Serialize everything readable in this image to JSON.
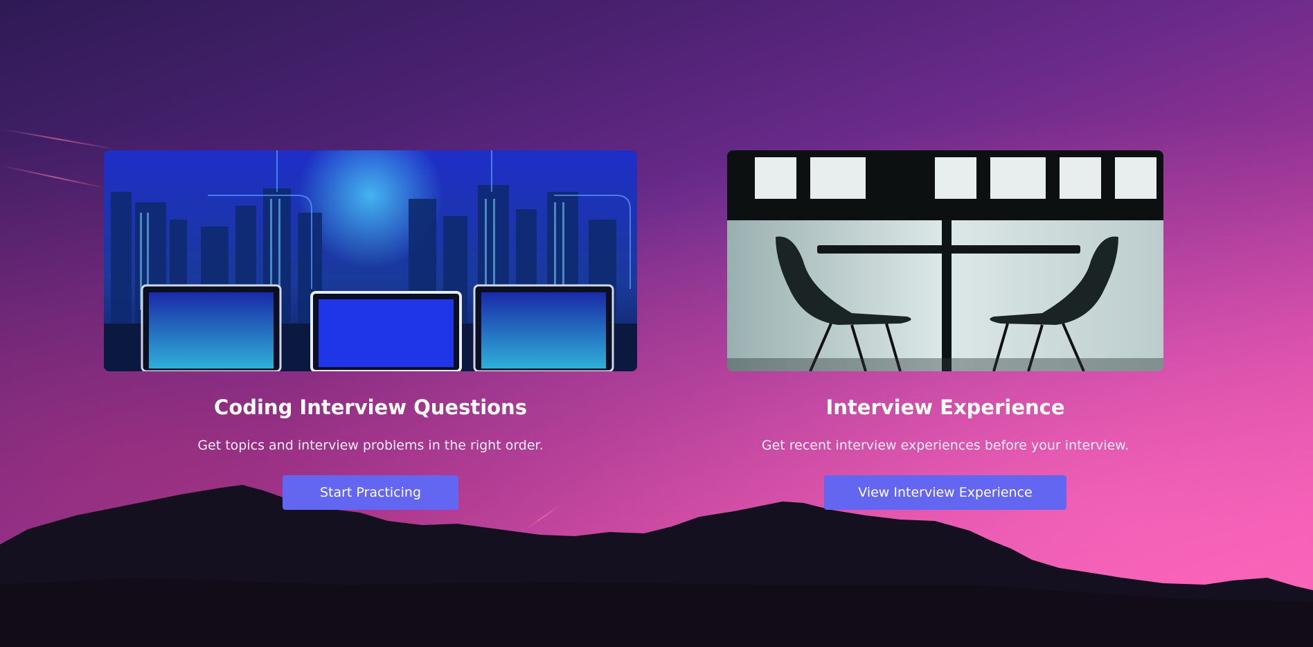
{
  "cards": [
    {
      "title": "Coding Interview Questions",
      "description": "Get topics and interview problems in the right order.",
      "button_label": "Start Practicing",
      "image": "city-binary-laptops-illustration"
    },
    {
      "title": "Interview Experience",
      "description": "Get recent interview experiences before your interview.",
      "button_label": "View Interview Experience",
      "image": "two-chairs-table-silhouette-photo"
    }
  ],
  "colors": {
    "button": "#6366f1",
    "text": "#ffffff",
    "background_top": "#2e1a55",
    "background_bottom": "#f25ab5"
  }
}
